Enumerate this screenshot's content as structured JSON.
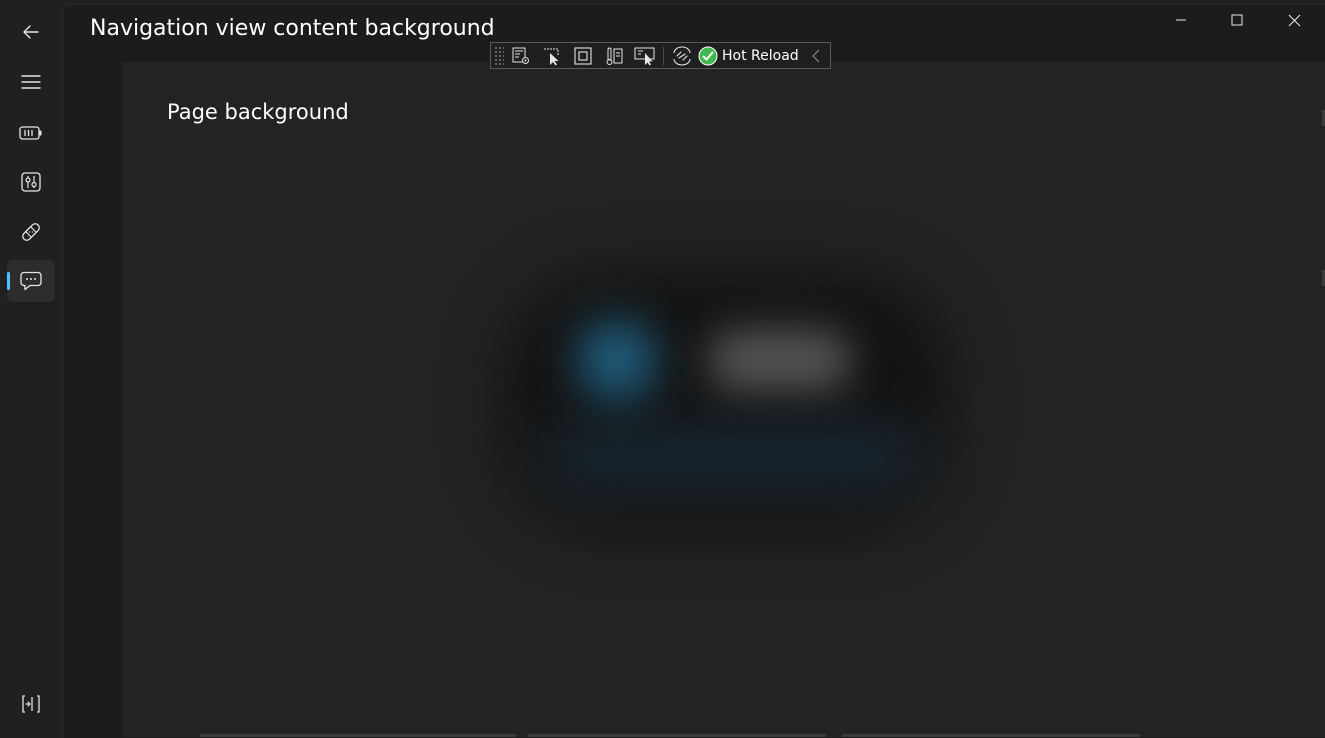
{
  "window": {
    "nav_title": "Navigation view content background"
  },
  "page": {
    "title": "Page background"
  },
  "nav": {
    "items": [
      {
        "icon": "back-arrow-icon"
      },
      {
        "icon": "hamburger-menu-icon"
      },
      {
        "icon": "battery-icon"
      },
      {
        "icon": "sliders-icon"
      },
      {
        "icon": "bandage-icon"
      },
      {
        "icon": "chat-icon",
        "selected": true
      }
    ],
    "footer": {
      "icon": "pane-toggle-icon"
    }
  },
  "caption_buttons": {
    "icons": [
      "minimize-icon",
      "maximize-icon",
      "close-icon"
    ]
  },
  "debug_toolbar": {
    "buttons": [
      "live-visual-tree-icon",
      "select-element-icon",
      "display-layout-adorners-icon",
      "track-focus-icon",
      "preview-selection-icon",
      "binding-failures-icon"
    ],
    "hot_reload_label": "Hot Reload",
    "accent": "#3fb950"
  },
  "colors": {
    "window_bg": "#202020",
    "page_bg": "#232323",
    "accent": "#4cc2ff"
  }
}
